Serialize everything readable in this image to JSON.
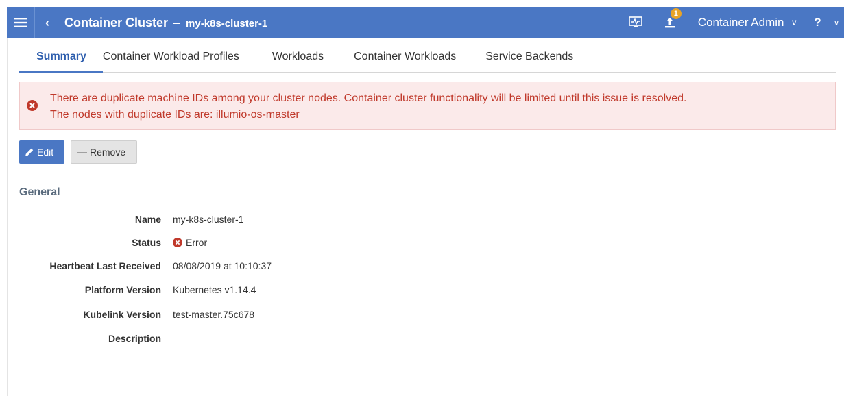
{
  "header": {
    "title": "Container Cluster",
    "separator": "–",
    "subtitle": "my-k8s-cluster-1",
    "notification_count": "1",
    "user_label": "Container Admin",
    "help_label": "?",
    "accent_color": "#4a77c4"
  },
  "tabs": [
    {
      "label": "Summary",
      "active": true
    },
    {
      "label": "Container Workload Profiles",
      "active": false
    },
    {
      "label": "Workloads",
      "active": false
    },
    {
      "label": "Container Workloads",
      "active": false
    },
    {
      "label": "Service Backends",
      "active": false
    }
  ],
  "alert": {
    "line1": "There are duplicate machine IDs among your cluster nodes.  Container cluster functionality will be limited until this issue is resolved.",
    "line2": "The nodes with duplicate IDs are: illumio-os-master",
    "color": "#c0392b"
  },
  "toolbar": {
    "edit_label": "Edit",
    "remove_label": "Remove"
  },
  "general": {
    "title": "General",
    "rows": [
      {
        "label": "Name",
        "value": "my-k8s-cluster-1"
      },
      {
        "label": "Status",
        "value": "Error"
      },
      {
        "label": "Heartbeat Last Received",
        "value": "08/08/2019 at 10:10:37"
      },
      {
        "label": "Platform Version",
        "value": "Kubernetes v1.14.4"
      },
      {
        "label": "Kubelink Version",
        "value": "test-master.75c678"
      },
      {
        "label": "Description",
        "value": ""
      }
    ]
  },
  "icons": {
    "menu": "hamburger-icon",
    "back": "chevron-left-icon",
    "monitor": "monitor-health-icon",
    "upload": "upload-icon",
    "error": "error-x-circle-icon",
    "edit": "pencil-icon"
  }
}
